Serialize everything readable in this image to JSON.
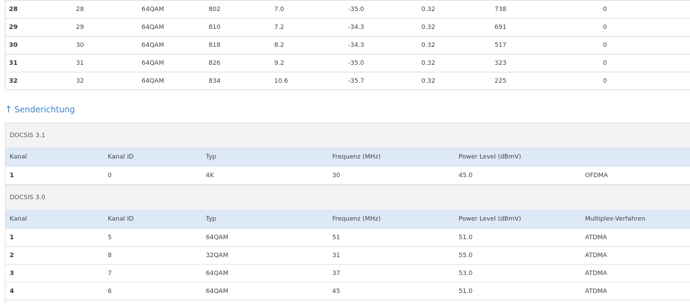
{
  "downstream": {
    "rows": [
      {
        "kanal": "28",
        "kanal_id": "28",
        "typ": "64QAM",
        "frequenz": "802",
        "power": "7.0",
        "mse": "-35.0",
        "latenz": "0.32",
        "korrigierbar": "738",
        "nicht_korrigierbar": "0"
      },
      {
        "kanal": "29",
        "kanal_id": "29",
        "typ": "64QAM",
        "frequenz": "810",
        "power": "7.2",
        "mse": "-34.3",
        "latenz": "0.32",
        "korrigierbar": "691",
        "nicht_korrigierbar": "0"
      },
      {
        "kanal": "30",
        "kanal_id": "30",
        "typ": "64QAM",
        "frequenz": "818",
        "power": "8.2",
        "mse": "-34.3",
        "latenz": "0.32",
        "korrigierbar": "517",
        "nicht_korrigierbar": "0"
      },
      {
        "kanal": "31",
        "kanal_id": "31",
        "typ": "64QAM",
        "frequenz": "826",
        "power": "9.2",
        "mse": "-35.0",
        "latenz": "0.32",
        "korrigierbar": "323",
        "nicht_korrigierbar": "0"
      },
      {
        "kanal": "32",
        "kanal_id": "32",
        "typ": "64QAM",
        "frequenz": "834",
        "power": "10.6",
        "mse": "-35.7",
        "latenz": "0.32",
        "korrigierbar": "225",
        "nicht_korrigierbar": "0"
      }
    ]
  },
  "upstream": {
    "link_arrow": "↑",
    "link_label": "Senderichtung",
    "docsis31": {
      "title": "DOCSIS 3.1",
      "headers": {
        "kanal": "Kanal",
        "kanal_id": "Kanal ID",
        "typ": "Typ",
        "frequenz": "Frequenz (MHz)",
        "power": "Power Level (dBmV)",
        "verfahren": ""
      },
      "rows": [
        {
          "kanal": "1",
          "kanal_id": "0",
          "typ": "4K",
          "frequenz": "30",
          "power": "45.0",
          "verfahren": "OFDMA"
        }
      ]
    },
    "docsis30": {
      "title": "DOCSIS 3.0",
      "headers": {
        "kanal": "Kanal",
        "kanal_id": "Kanal ID",
        "typ": "Typ",
        "frequenz": "Frequenz (MHz)",
        "power": "Power Level (dBmV)",
        "verfahren": "Multiplex-Verfahren"
      },
      "rows": [
        {
          "kanal": "1",
          "kanal_id": "5",
          "typ": "64QAM",
          "frequenz": "51",
          "power": "51.0",
          "verfahren": "ATDMA"
        },
        {
          "kanal": "2",
          "kanal_id": "8",
          "typ": "32QAM",
          "frequenz": "31",
          "power": "55.0",
          "verfahren": "ATDMA"
        },
        {
          "kanal": "3",
          "kanal_id": "7",
          "typ": "64QAM",
          "frequenz": "37",
          "power": "53.0",
          "verfahren": "ATDMA"
        },
        {
          "kanal": "4",
          "kanal_id": "6",
          "typ": "64QAM",
          "frequenz": "45",
          "power": "51.0",
          "verfahren": "ATDMA"
        }
      ]
    }
  },
  "colors": {
    "link": "#3d85c6",
    "header_bg": "#dde9f6",
    "group_bg": "#f3f3f3"
  }
}
